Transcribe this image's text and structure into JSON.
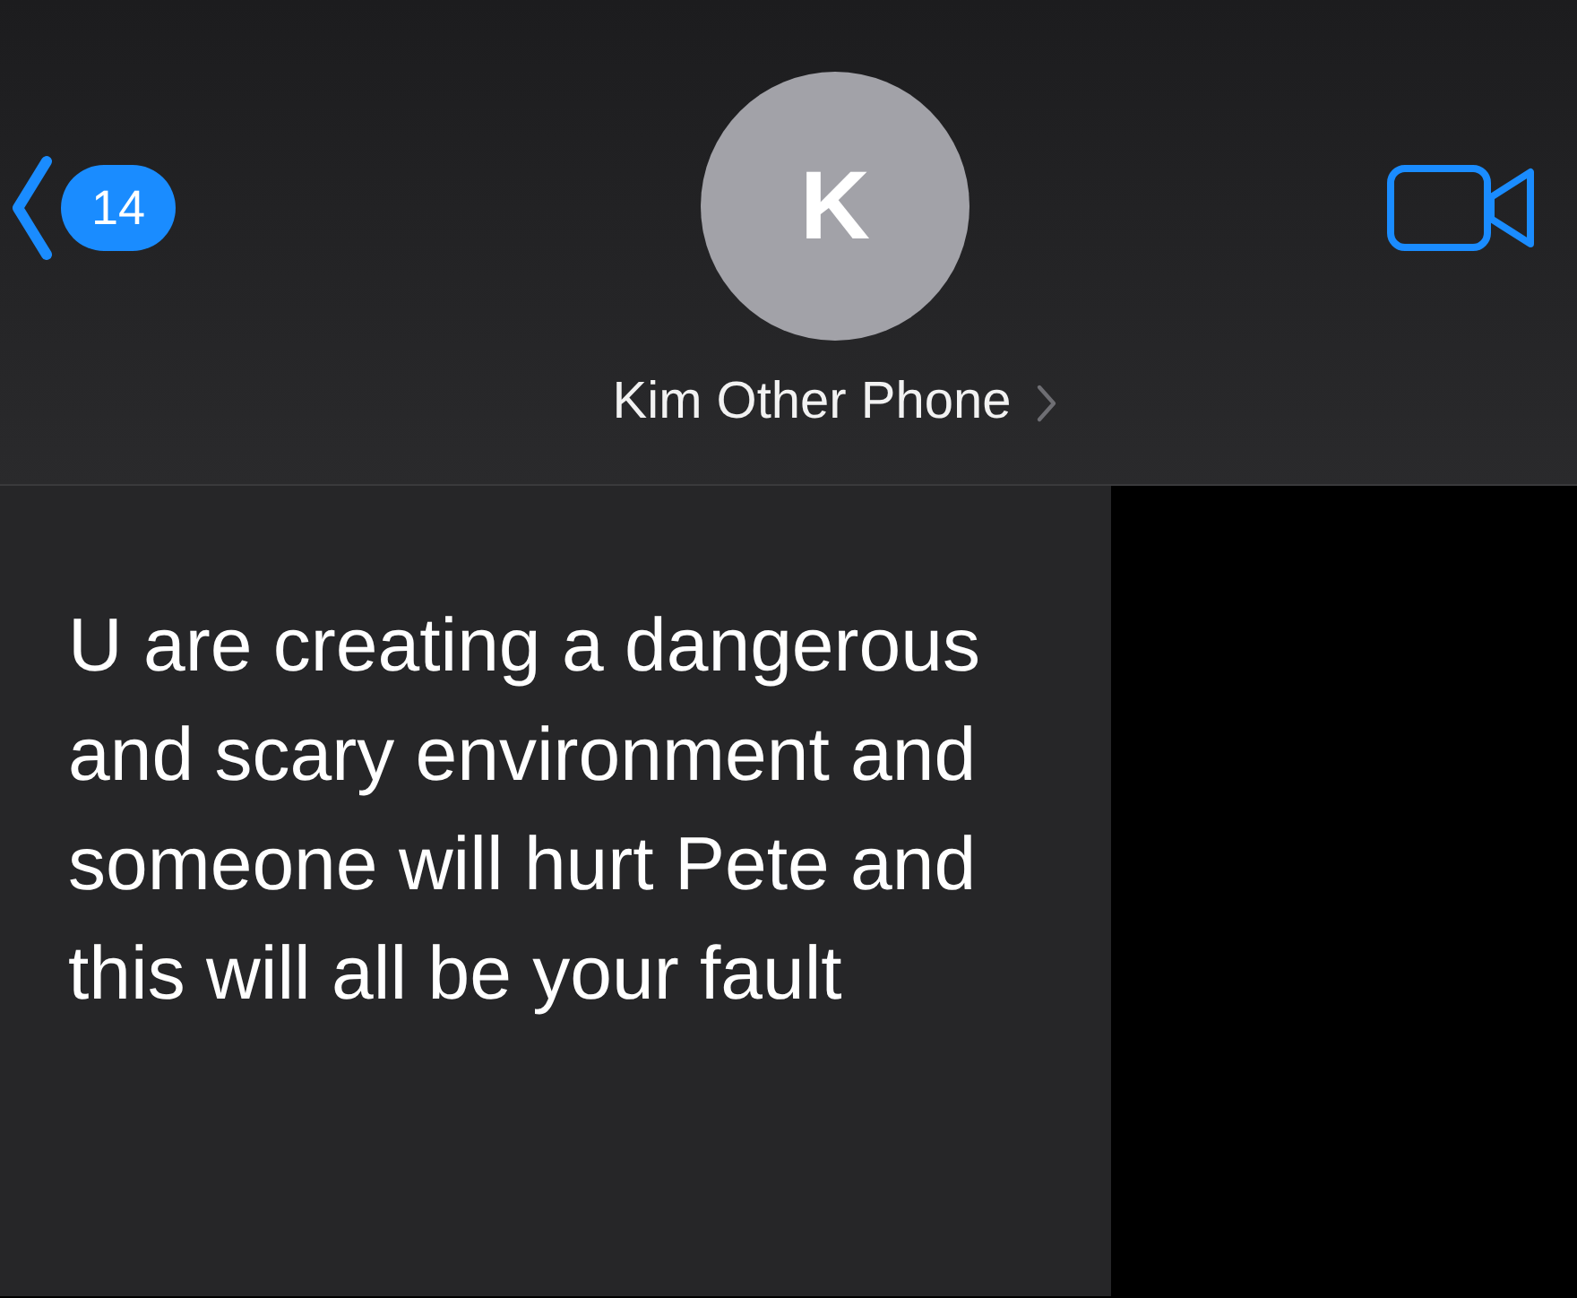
{
  "header": {
    "back_badge": "14",
    "avatar_initial": "K",
    "contact_name": "Kim Other Phone"
  },
  "messages": [
    {
      "kind": "incoming",
      "text": "U are creating a dangerous and scary environment and someone will hurt Pete and this will all be your fault"
    }
  ]
}
